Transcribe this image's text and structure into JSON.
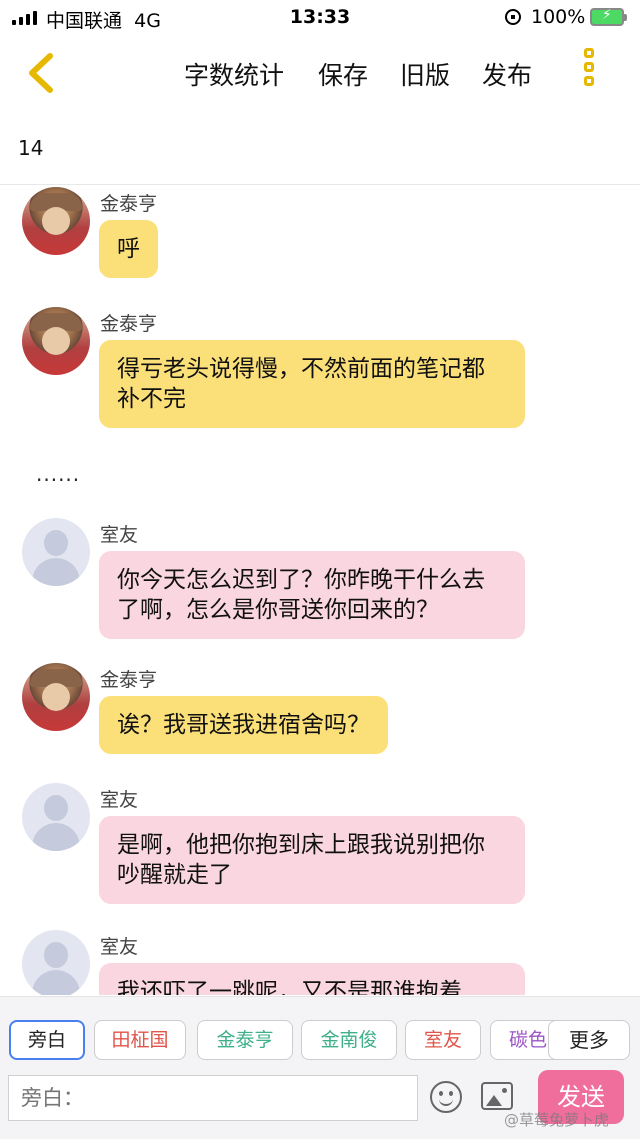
{
  "status_bar": {
    "carrier": "中国联通",
    "network": "4G",
    "time": "13:33",
    "battery": "100%"
  },
  "toolbar": {
    "word_count": "字数统计",
    "save": "保存",
    "old_version": "旧版",
    "publish": "发布"
  },
  "word_count_value": "14",
  "messages": [
    {
      "sender": "金泰亨",
      "text": "呼",
      "color": "#fbe07a"
    },
    {
      "sender": "金泰亨",
      "text": "得亏老头说得慢，不然前面的笔记都补不完",
      "color": "#fbe07a"
    },
    {
      "narration": "......"
    },
    {
      "sender": "室友",
      "text": "你今天怎么迟到了？你昨晚干什么去了啊，怎么是你哥送你回来的？",
      "color": "#f9d6e0"
    },
    {
      "sender": "金泰亨",
      "text": "诶？我哥送我进宿舍吗？",
      "color": "#fbe07a"
    },
    {
      "sender": "室友",
      "text": "是啊，他把你抱到床上跟我说别把你吵醒就走了",
      "color": "#f9d6e0"
    },
    {
      "sender": "室友",
      "text": "我还吓了一跳呢，又不是那谁抱着",
      "color": "#f9d6e0"
    }
  ],
  "roles": [
    {
      "label": "旁白",
      "color": "#222222"
    },
    {
      "label": "田柾国",
      "color": "#e0554a"
    },
    {
      "label": "金泰亨",
      "color": "#3fb08a"
    },
    {
      "label": "金南俊",
      "color": "#3fb08a"
    },
    {
      "label": "室友",
      "color": "#e0554a"
    },
    {
      "label": "碳色",
      "color": "#9a55c8"
    }
  ],
  "roles_more": "更多",
  "input": {
    "placeholder": "旁白："
  },
  "send": "发送",
  "watermark": "@草莓兔萝卜虎"
}
